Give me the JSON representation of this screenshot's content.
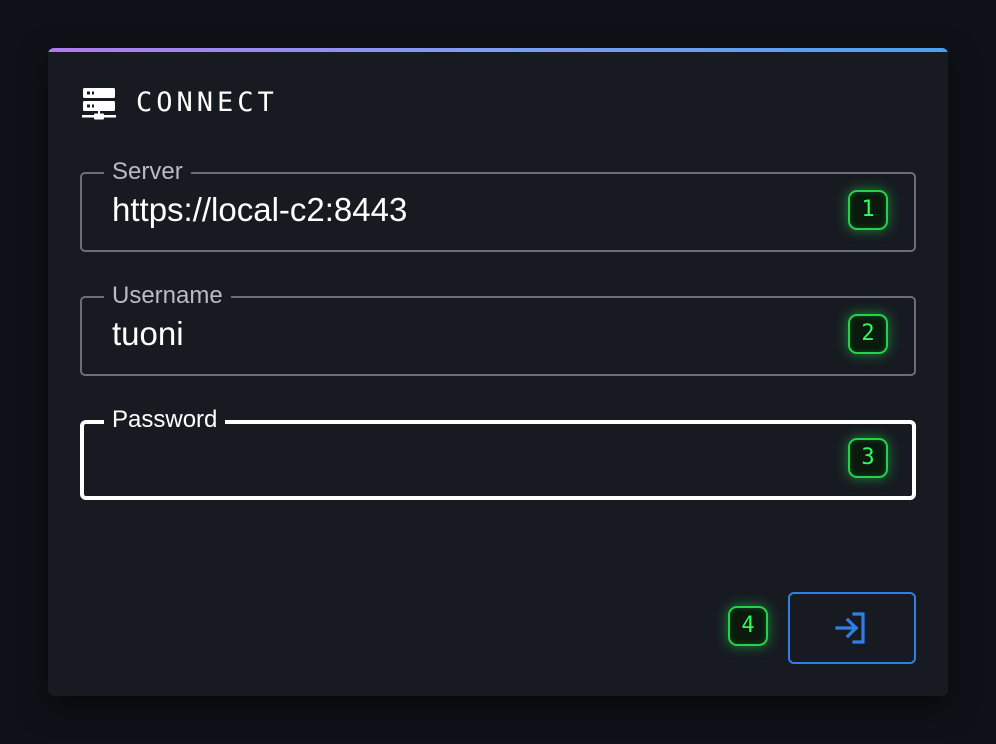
{
  "header": {
    "title": "CONNECT",
    "icon": "server-network-icon"
  },
  "form": {
    "server": {
      "label": "Server",
      "value": "https://local-c2:8443",
      "hint_badge": "1"
    },
    "username": {
      "label": "Username",
      "value": "tuoni",
      "hint_badge": "2"
    },
    "password": {
      "label": "Password",
      "value": "",
      "hint_badge": "3",
      "focused": true
    }
  },
  "actions": {
    "login_icon": "login-arrow-icon",
    "hint_badge": "4"
  },
  "colors": {
    "background": "#0e1117",
    "card": "#171b21",
    "accent_gradient_start": "#b07cf0",
    "accent_gradient_end": "#4aa2f2",
    "badge_green": "#2bff5a",
    "button_blue": "#2f7fe6"
  }
}
